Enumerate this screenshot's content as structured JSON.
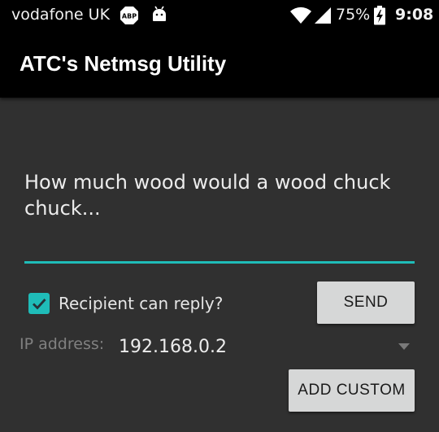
{
  "status_bar": {
    "carrier": "vodafone UK",
    "abp_icon_label": "ABP",
    "battery_percent": "75%",
    "time": "9:08",
    "icons": [
      "abp-icon",
      "android-icon",
      "wifi-icon",
      "signal-icon",
      "battery-charging-icon"
    ]
  },
  "app_bar": {
    "title": "ATC's Netmsg Utility"
  },
  "message": {
    "value": "How much wood would a wood chuck chuck..."
  },
  "reply_checkbox": {
    "label": "Recipient can reply?",
    "checked": true
  },
  "send_button": {
    "label": "SEND"
  },
  "ip": {
    "label": "IP address:",
    "selected": "192.168.0.2"
  },
  "add_custom_button": {
    "label": "ADD CUSTOM"
  },
  "colors": {
    "accent": "#1fbcb8",
    "background": "#303030",
    "toolbar": "#000000",
    "button": "#d6d7d7"
  }
}
